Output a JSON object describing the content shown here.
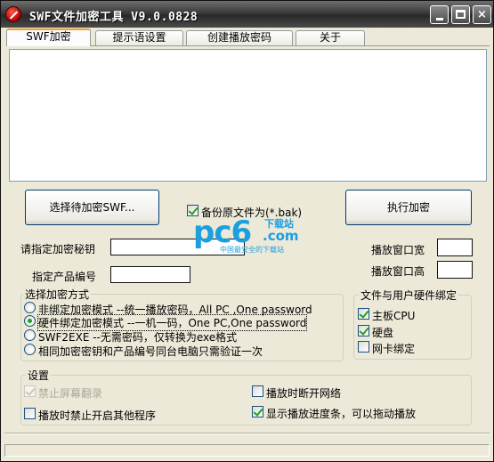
{
  "window": {
    "title": "SWF文件加密工具 V9.0.0828",
    "buttons": {
      "minimize": "minimize",
      "maximize": "maximize",
      "close": "×"
    }
  },
  "tabs": [
    {
      "label": "SWF加密",
      "active": true
    },
    {
      "label": "提示语设置",
      "active": false
    },
    {
      "label": "创建播放密码",
      "active": false
    },
    {
      "label": "关于",
      "active": false
    }
  ],
  "main": {
    "select_button": "选择待加密SWF...",
    "backup_label": "备份原文件为(*.bak)",
    "backup_checked": true,
    "execute_button": "执行加密",
    "key_label": "请指定加密秘钥",
    "key_value": "",
    "product_label": "指定产品编号",
    "product_value": "",
    "window_width_label": "播放窗口宽",
    "window_width_value": "",
    "window_height_label": "播放窗口高",
    "window_height_value": ""
  },
  "mode_group": {
    "title": "选择加密方式",
    "options": [
      {
        "label": "非绑定加密模式 --统一播放密码，All PC ,One password",
        "checked": false
      },
      {
        "label": "硬件绑定加密模式 --一机一码，One PC,One password",
        "checked": true
      },
      {
        "label": "SWF2EXE --无需密码，仅转换为exe格式",
        "checked": false
      },
      {
        "label": "相同加密密钥和产品编号同台电脑只需验证一次",
        "checked": false
      }
    ]
  },
  "hardware_group": {
    "title": "文件与用户硬件绑定",
    "items": [
      {
        "label": "主板CPU",
        "checked": true
      },
      {
        "label": "硬盘",
        "checked": true
      },
      {
        "label": "网卡绑定",
        "checked": false
      }
    ]
  },
  "settings_group": {
    "title": "设置",
    "disable_screen_record": "禁止屏幕翻录",
    "disable_screen_record_checked": true,
    "disable_other_programs": "播放时禁止开启其他程序",
    "disable_other_programs_checked": false,
    "disconnect_network": "播放时断开网络",
    "disconnect_network_checked": false,
    "show_progress": "显示播放进度条，可以拖动播放",
    "show_progress_checked": true
  },
  "watermark": {
    "brand": "pc6",
    "site": "下载站",
    "com": ".com",
    "sub": "中国最安全的下载站"
  }
}
